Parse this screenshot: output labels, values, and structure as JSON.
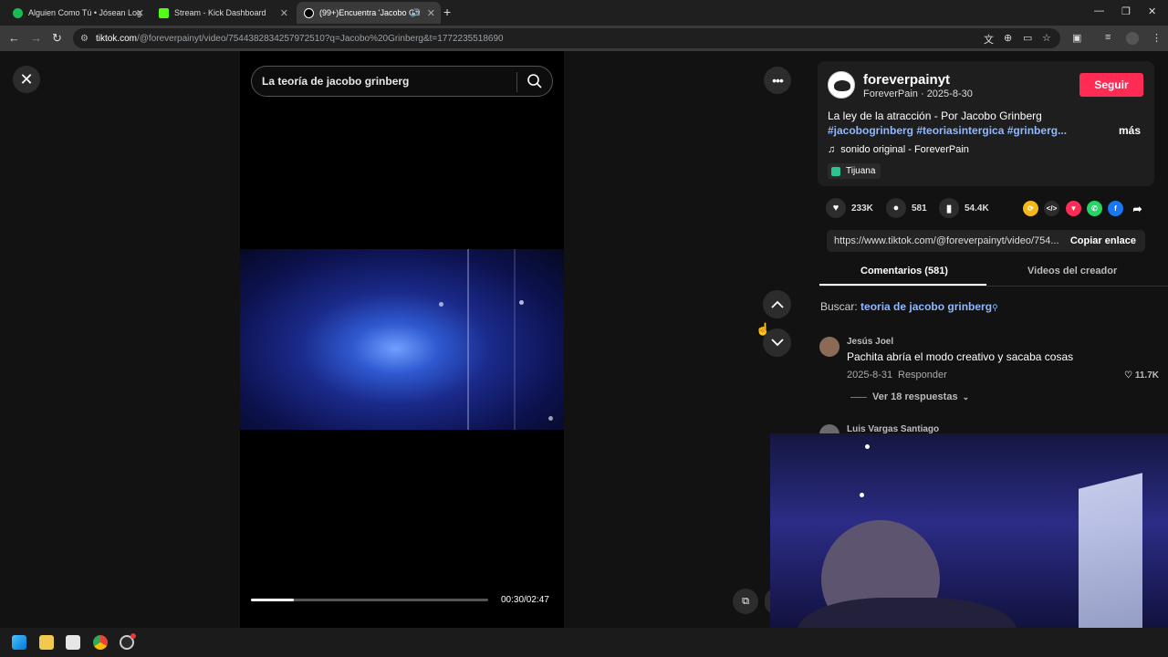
{
  "browser": {
    "tabs": [
      {
        "title": "Alguien Como Tú • Jósean Log",
        "favicon_color": "#1db954"
      },
      {
        "title": "Stream - Kick Dashboard",
        "favicon_color": "#53fc18"
      },
      {
        "title": "(99+)Encuentra 'Jacobo Gri",
        "favicon_color": "#ffffff",
        "active": true
      }
    ],
    "url_host": "tiktok.com",
    "url_path": "/@foreverpainyt/video/7544382834257972510?q=Jacobo%20Grinberg&t=1772235518690"
  },
  "player": {
    "search_value": "La teoría de jacobo grinberg",
    "progress": 0.18,
    "time": "00:30/02:47"
  },
  "author": {
    "username": "foreverpainyt",
    "meta": "ForeverPain · 2025-8-30",
    "follow_label": "Seguir",
    "description": "La ley de la atracción - Por Jacobo Grinberg",
    "hashtags": "#jacobogrinberg #teoriasintergica #grinberg...",
    "more_label": "más",
    "sound": "sonido original - ForeverPain",
    "location": "Tijuana"
  },
  "stats": {
    "likes": "233K",
    "comments": "581",
    "saves": "54.4K"
  },
  "share_link": {
    "url": "https://www.tiktok.com/@foreverpainyt/video/754...",
    "copy_label": "Copiar enlace"
  },
  "panel_tabs": {
    "comments": "Comentarios (581)",
    "creator_videos": "Videos del creador"
  },
  "search_hint": {
    "prefix": "Buscar:",
    "query": "teoria de jacobo grinberg"
  },
  "comments": [
    {
      "user": "Jesús Joel",
      "text": "Pachita abría el modo creativo y sacaba cosas",
      "date": "2025-8-31",
      "reply_label": "Responder",
      "likes": "11.7K",
      "view_replies": "Ver 18 respuestas"
    },
    {
      "user": "Luis Vargas Santiago"
    }
  ],
  "colors": {
    "follow": "#fe2c55",
    "hashtag": "#8fb8ff"
  }
}
